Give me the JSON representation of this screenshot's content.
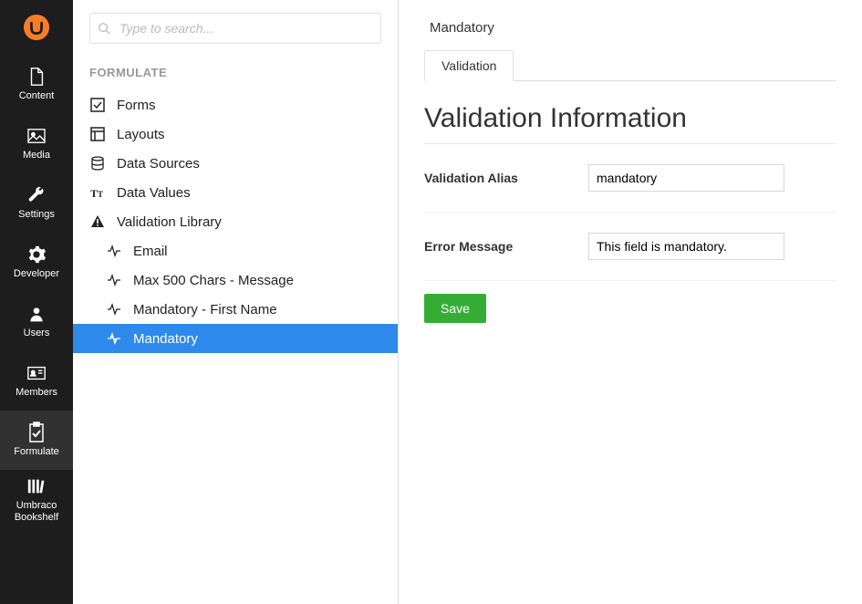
{
  "navbar": {
    "items": [
      {
        "id": "content",
        "label": "Content"
      },
      {
        "id": "media",
        "label": "Media"
      },
      {
        "id": "settings",
        "label": "Settings"
      },
      {
        "id": "developer",
        "label": "Developer"
      },
      {
        "id": "users",
        "label": "Users"
      },
      {
        "id": "members",
        "label": "Members"
      },
      {
        "id": "formulate",
        "label": "Formulate"
      },
      {
        "id": "bookshelf",
        "label": "Umbraco Bookshelf"
      }
    ],
    "active": "formulate"
  },
  "search": {
    "placeholder": "Type to search..."
  },
  "tree": {
    "section_header": "FORMULATE",
    "items": [
      {
        "label": "Forms",
        "icon": "checkbox"
      },
      {
        "label": "Layouts",
        "icon": "layout"
      },
      {
        "label": "Data Sources",
        "icon": "database"
      },
      {
        "label": "Data Values",
        "icon": "typography"
      },
      {
        "label": "Validation Library",
        "icon": "warning"
      }
    ],
    "children": [
      {
        "label": "Email"
      },
      {
        "label": "Max 500 Chars - Message"
      },
      {
        "label": "Mandatory - First Name"
      },
      {
        "label": "Mandatory",
        "selected": true
      }
    ]
  },
  "main": {
    "breadcrumb": "Mandatory",
    "tab": "Validation",
    "heading": "Validation Information",
    "fields": {
      "alias_label": "Validation Alias",
      "alias_value": "mandatory",
      "error_label": "Error Message",
      "error_value": "This field is mandatory."
    },
    "save_label": "Save"
  }
}
